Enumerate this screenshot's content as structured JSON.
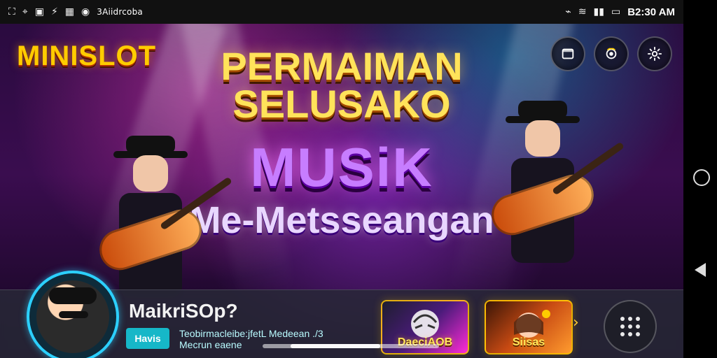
{
  "status_bar": {
    "carrier": "3Aiidrcoba",
    "time": "B2:30 AM"
  },
  "banner": {
    "brand": "MINISLOT",
    "title_line1": "PERMAIMAN",
    "title_line2": "SELUSAKO",
    "title_line3": "MUSiK",
    "subtitle": "Me-Metsseangan"
  },
  "profile": {
    "name": "MaikriSOp?",
    "chip_label": "Havis",
    "description_line1": "Teobirmacleibe:jfetL Medeean ./3",
    "description_line2": "Mecrun eaene"
  },
  "games": [
    {
      "title": "DaeciAOB"
    },
    {
      "title": "Siisas"
    }
  ],
  "icons": {
    "status_left": [
      "cast-icon",
      "location-icon",
      "image-icon",
      "bolt-icon",
      "qr-icon",
      "message-icon"
    ],
    "status_right": [
      "nfc-icon",
      "wifi-icon",
      "signal-icon",
      "battery-icon"
    ],
    "top_right": [
      "window-icon",
      "camera-icon",
      "gear-icon"
    ],
    "bottom_right": "grid-icon"
  }
}
